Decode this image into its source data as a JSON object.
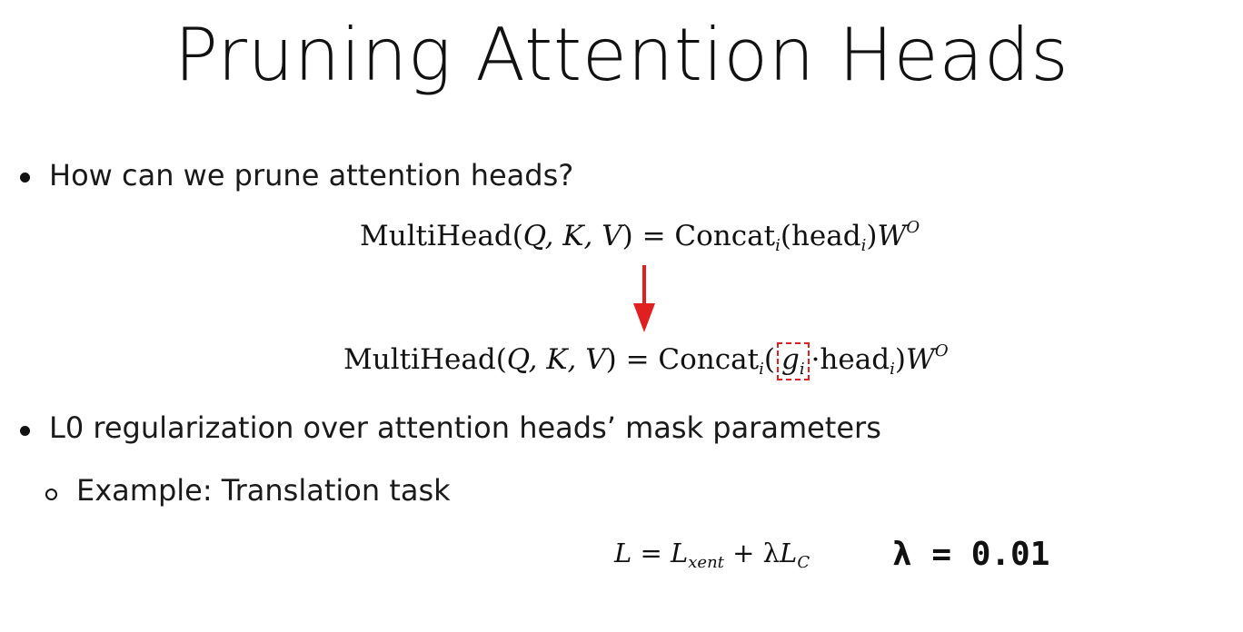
{
  "slide": {
    "title": "Pruning Attention Heads",
    "bullet1": "How can we prune attention heads?",
    "eq1": {
      "lhs": "MultiHead(",
      "args": "Q, K, V",
      "mid": ") = Concat",
      "sub_i": "i",
      "paren_open": "(head",
      "sub_i2": "i",
      "paren_close": ")",
      "w": "W",
      "sup": "O"
    },
    "eq2": {
      "lhs": "MultiHead(",
      "args": "Q, K, V",
      "mid": ") = Concat",
      "sub_i": "i",
      "paren_open": "(",
      "g": "g",
      "g_sub": "i",
      "dot": "·head",
      "sub_i2": "i",
      "paren_close": ")",
      "w": "W",
      "sup": "O"
    },
    "bullet2": "L0 regularization over attention heads’ mask parameters",
    "sub_bullet": "Example: Translation task",
    "loss": {
      "L": "L",
      "eq": " = ",
      "Lx": "L",
      "xent": "xent",
      "plus": " + λ",
      "Lc": "L",
      "c": "C"
    },
    "lambda_value": "λ = 0.01",
    "colors": {
      "arrow": "#e02020",
      "dashed_box": "#e02020"
    }
  }
}
